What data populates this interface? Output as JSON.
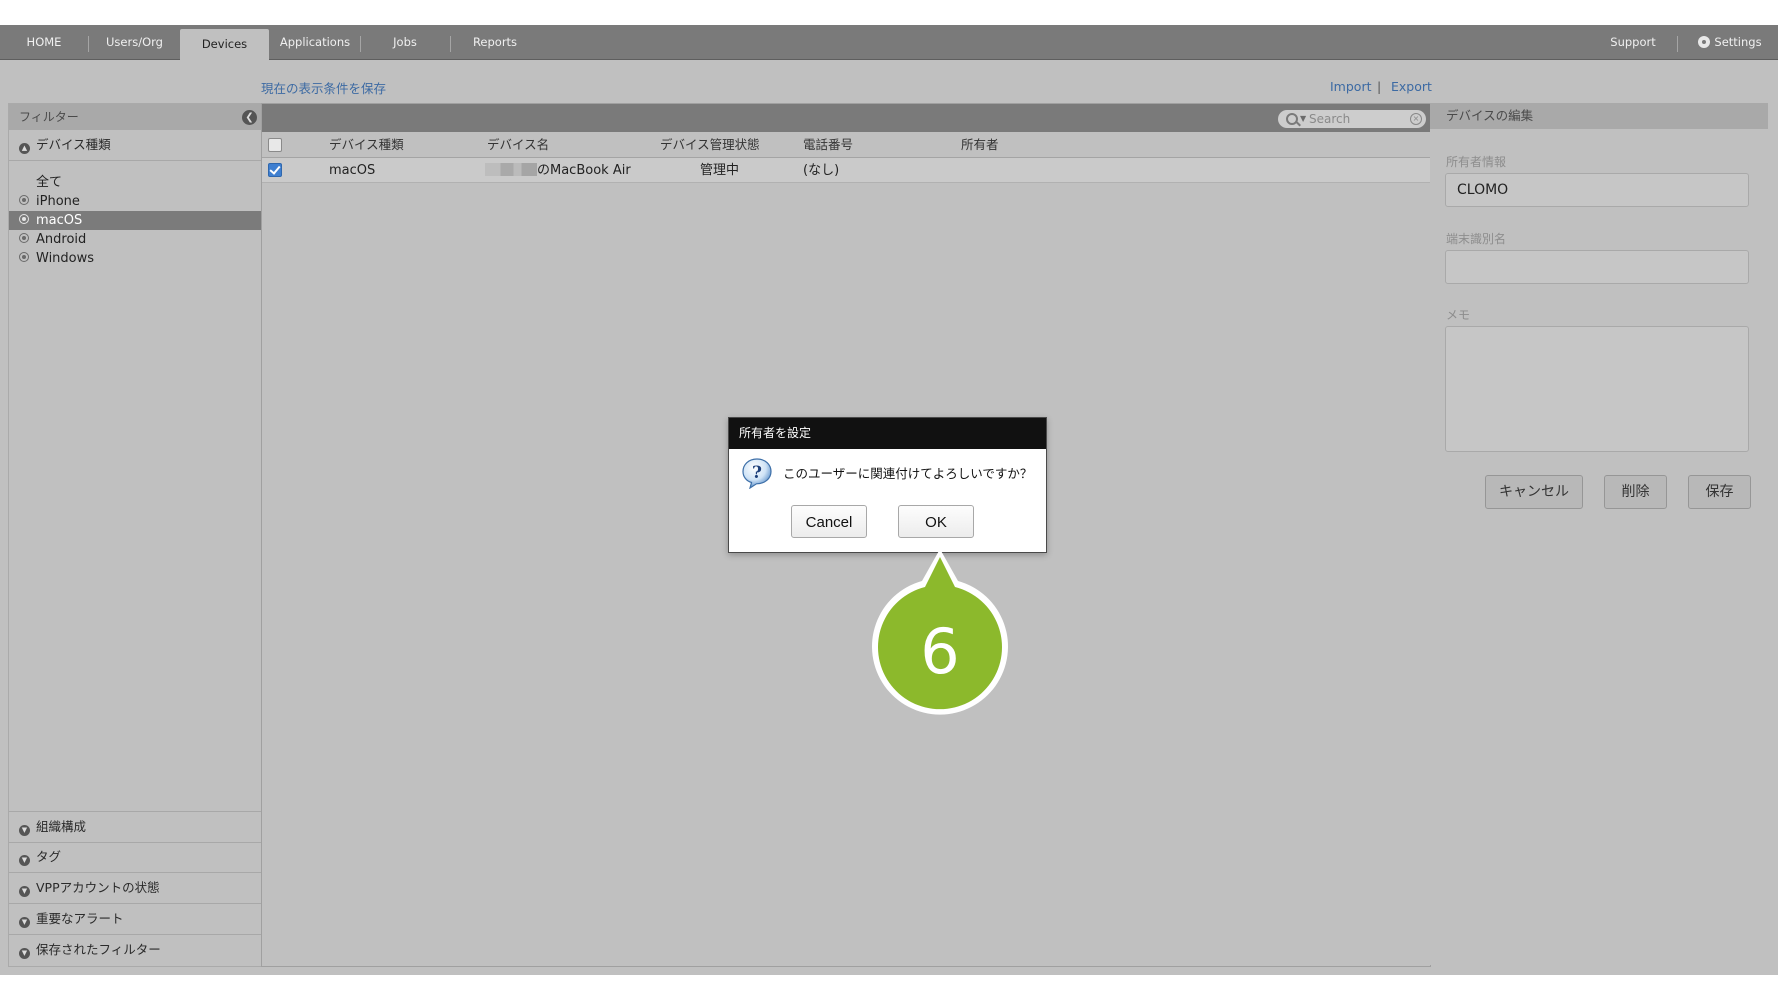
{
  "nav": {
    "items": [
      "HOME",
      "Users/Org",
      "Devices",
      "Applications",
      "Jobs",
      "Reports"
    ],
    "active": "Devices",
    "support": "Support",
    "settings": "Settings"
  },
  "subbar": {
    "save_view": "現在の表示条件を保存",
    "import": "Import",
    "sep": "|",
    "export": "Export"
  },
  "filter": {
    "header": "フィルター",
    "device_type_section": "デバイス種類",
    "items": [
      "全て",
      "iPhone",
      "macOS",
      "Android",
      "Windows"
    ],
    "selected": "macOS",
    "bottom_sections": [
      "組織構成",
      "タグ",
      "VPPアカウントの状態",
      "重要なアラート",
      "保存されたフィルター"
    ]
  },
  "list": {
    "search_placeholder": "Search",
    "columns": [
      "デバイス種類",
      "デバイス名",
      "デバイス管理状態",
      "電話番号",
      "所有者"
    ],
    "rows": [
      {
        "checked": true,
        "type": "macOS",
        "name_suffix": "のMacBook Air",
        "state": "管理中",
        "phone": "(なし)",
        "owner": ""
      }
    ]
  },
  "edit": {
    "header": "デバイスの編集",
    "owner_label": "所有者情報",
    "owner_value": "CLOMO",
    "alias_label": "端末識別名",
    "alias_value": "",
    "memo_label": "メモ",
    "memo_value": "",
    "cancel": "キャンセル",
    "delete": "削除",
    "save": "保存"
  },
  "dialog": {
    "title": "所有者を設定",
    "message": "このユーザーに関連付けてよろしいですか？",
    "cancel": "Cancel",
    "ok": "OK"
  },
  "callout": {
    "step": "6",
    "color": "#8cb92c"
  }
}
